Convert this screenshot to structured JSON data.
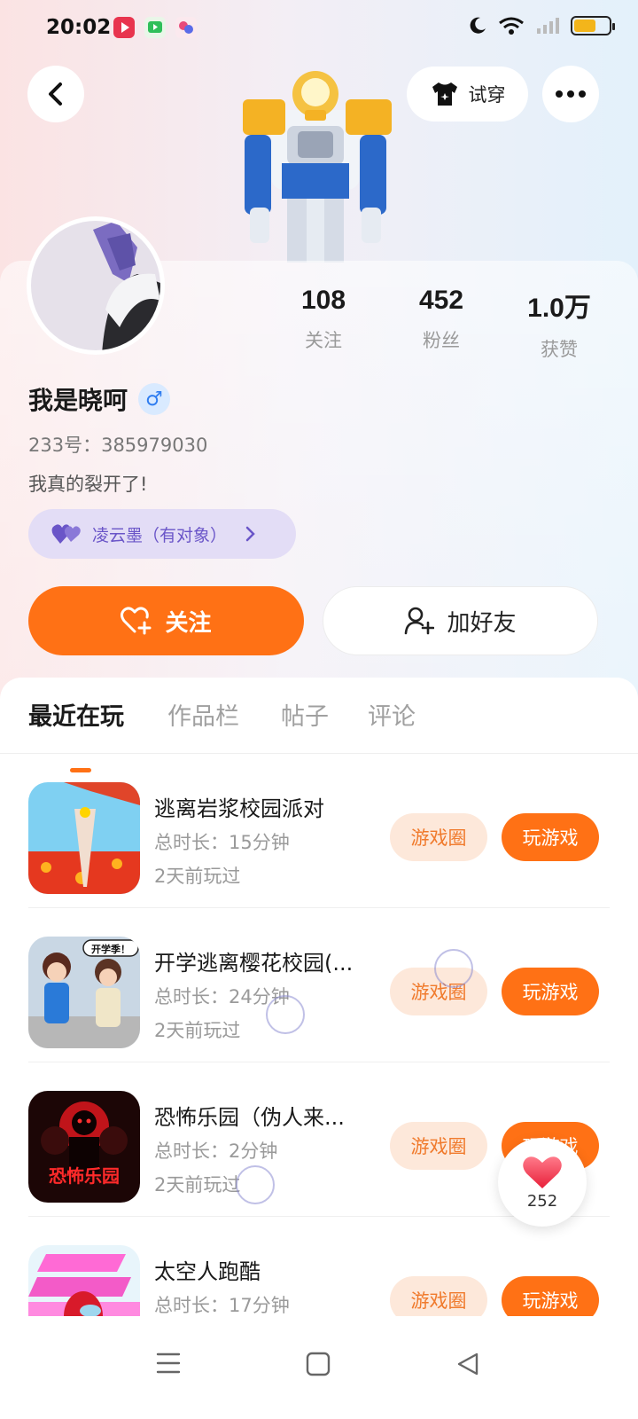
{
  "status_bar": {
    "time": "20:02",
    "battery_color": "#f3b51b"
  },
  "header": {
    "back_icon": "back-arrow-icon",
    "try_on_label": "试穿",
    "more_icon": "more-icon"
  },
  "profile": {
    "name": "我是晓呵",
    "gender_symbol": "♂",
    "id_line": "233号：385979030",
    "bio": "我真的裂开了!",
    "couple_label": "凌云墨（有对象）",
    "stats": [
      {
        "value": "108",
        "label": "关注"
      },
      {
        "value": "452",
        "label": "粉丝"
      },
      {
        "value": "1.0万",
        "label": "获赞"
      }
    ]
  },
  "actions": {
    "follow_label": "关注",
    "add_friend_label": "加好友"
  },
  "tabs": [
    {
      "label": "最近在玩",
      "active": true
    },
    {
      "label": "作品栏",
      "active": false
    },
    {
      "label": "帖子",
      "active": false
    },
    {
      "label": "评论",
      "active": false
    }
  ],
  "games": [
    {
      "title": "逃离岩浆校园派对",
      "duration": "总时长：15分钟",
      "last_played": "2天前玩过",
      "circle_label": "游戏圈",
      "play_label": "玩游戏"
    },
    {
      "title": "开学逃离樱花校园(...",
      "duration": "总时长：24分钟",
      "last_played": "2天前玩过",
      "circle_label": "游戏圈",
      "play_label": "玩游戏"
    },
    {
      "title": "恐怖乐园（伪人来...",
      "duration": "总时长：2分钟",
      "last_played": "2天前玩过",
      "circle_label": "游戏圈",
      "play_label": "玩游戏"
    },
    {
      "title": "太空人跑酷",
      "duration": "总时长：17分钟",
      "last_played": "",
      "circle_label": "游戏圈",
      "play_label": "玩游戏"
    }
  ],
  "game_icon_texts": {
    "game2_badge": "开学季！",
    "game3_logo": "恐怖乐园"
  },
  "like_float": {
    "count": "252"
  },
  "colors": {
    "accent": "#ff7115",
    "couple_bg": "#e3ddf6",
    "couple_text": "#6a55c8"
  }
}
